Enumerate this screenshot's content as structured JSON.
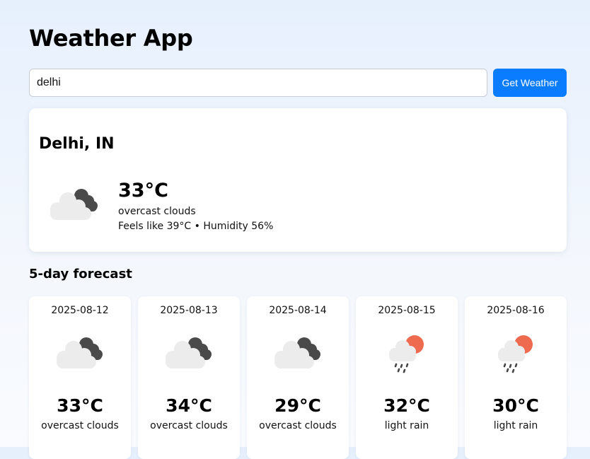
{
  "app": {
    "title": "Weather App"
  },
  "search": {
    "value": "delhi",
    "button_label": "Get Weather"
  },
  "current": {
    "city": "Delhi, IN",
    "temperature": "33°C",
    "description": "overcast clouds",
    "details": "Feels like 39°C • Humidity 56%",
    "icon": "overcast-clouds-icon"
  },
  "forecast": {
    "heading": "5-day forecast",
    "days": [
      {
        "date": "2025-08-12",
        "temp": "33°C",
        "desc": "overcast clouds",
        "icon": "overcast-clouds-icon"
      },
      {
        "date": "2025-08-13",
        "temp": "34°C",
        "desc": "overcast clouds",
        "icon": "overcast-clouds-icon"
      },
      {
        "date": "2025-08-14",
        "temp": "29°C",
        "desc": "overcast clouds",
        "icon": "overcast-clouds-icon"
      },
      {
        "date": "2025-08-15",
        "temp": "32°C",
        "desc": "light rain",
        "icon": "sun-rain-icon"
      },
      {
        "date": "2025-08-16",
        "temp": "30°C",
        "desc": "light rain",
        "icon": "sun-rain-icon"
      }
    ]
  },
  "colors": {
    "accent": "#0a7cff",
    "sun": "#ef6b4f",
    "dark_cloud": "#4a4a4a",
    "light_cloud": "#ececec"
  }
}
